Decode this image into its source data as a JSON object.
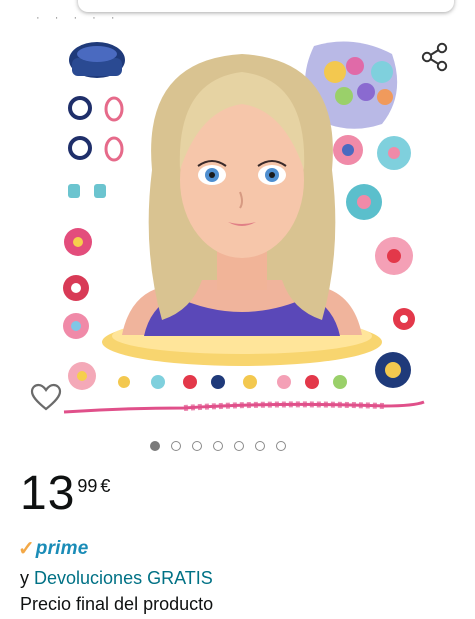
{
  "header": {
    "title_fragment": "· · · · ·"
  },
  "product": {
    "image_alt": "Doll styling head with accessories",
    "carousel": {
      "count": 7,
      "active": 0
    }
  },
  "price": {
    "whole": "13",
    "fraction": "99",
    "currency": "€"
  },
  "prime": {
    "check": "✓",
    "label": "prime"
  },
  "returns": {
    "prefix": "y ",
    "link": "Devoluciones GRATIS"
  },
  "final_price_note": "Precio final del producto",
  "colors": {
    "link": "#007185",
    "prime_blue": "#1a8cb7",
    "prime_check": "#f3a847"
  },
  "icons": {
    "share": "share-icon",
    "wishlist": "heart-outline-icon"
  }
}
